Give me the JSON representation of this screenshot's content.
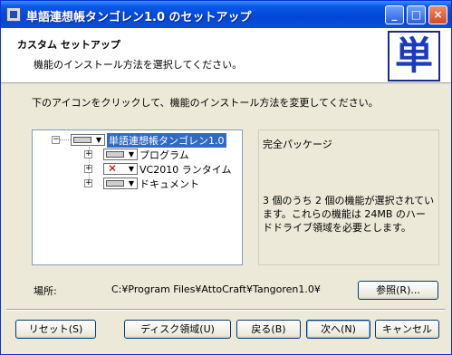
{
  "window": {
    "title": "単語連想帳タンゴレン1.0 のセットアップ",
    "buttons": {
      "minimize": "_",
      "maximize": "□",
      "close": "×"
    }
  },
  "header": {
    "title": "カスタム セットアップ",
    "description": "機能のインストール方法を選択してください。",
    "logo_char": "単"
  },
  "instruction": "下のアイコンをクリックして、機能のインストール方法を変更してください。",
  "tree": {
    "root": {
      "label": "単語連想帳タンゴレン1.0",
      "expander": "−"
    },
    "items": [
      {
        "label": "プログラム",
        "expander": "+",
        "state": "install"
      },
      {
        "label": "VC2010 ランタイム",
        "expander": "+",
        "state": "unavailable"
      },
      {
        "label": "ドキュメント",
        "expander": "+",
        "state": "install"
      }
    ]
  },
  "description_panel": {
    "title": "完全パッケージ",
    "text": "3 個のうち 2 個の機能が選択されています。これらの機能は 24MB のハードドライブ領域を必要とします。"
  },
  "location": {
    "label": "場所:",
    "path": "C:¥Program Files¥AttoCraft¥Tangoren1.0¥",
    "browse_button": "参照(R)..."
  },
  "footer_buttons": {
    "reset": "リセット(S)",
    "disk_cost": "ディスク領域(U)",
    "back": "戻る(B)",
    "next": "次へ(N)",
    "cancel": "キャンセル"
  },
  "colors": {
    "titlebar": "#0a58e6",
    "selection": "#316ac5",
    "logo_blue": "#1a3ac0"
  }
}
